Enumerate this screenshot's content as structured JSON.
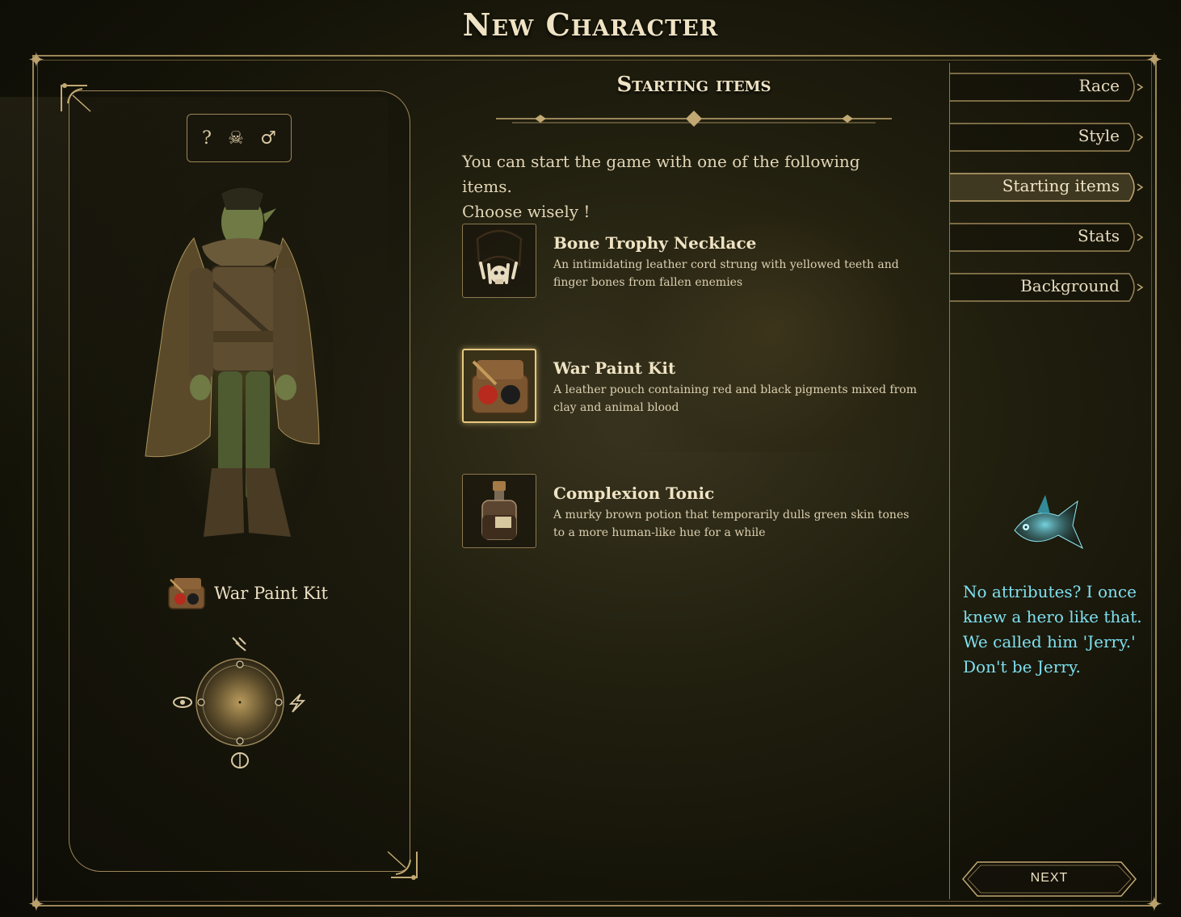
{
  "header": {
    "title": "New Character"
  },
  "character": {
    "tags": {
      "unknown": "?",
      "race_icon": "skull-icon",
      "gender_icon": "male-icon"
    },
    "selected_item": {
      "label": "War Paint Kit",
      "icon": "war-paint-kit-icon"
    },
    "attributes": [
      "dexterity-icon",
      "perception-icon",
      "energy-icon",
      "intellect-icon"
    ]
  },
  "starting_items": {
    "title": "Starting items",
    "intro": "You can start the game with one of the following items.\nChoose wisely !",
    "items": [
      {
        "name": "Bone Trophy Necklace",
        "description": "An intimidating leather cord strung with yellowed teeth and finger bones from fallen enemies",
        "icon": "bone-necklace-icon",
        "selected": false
      },
      {
        "name": "War Paint Kit",
        "description": "A leather pouch containing red and black pigments mixed from clay and animal blood",
        "icon": "war-paint-kit-icon",
        "selected": true
      },
      {
        "name": "Complexion Tonic",
        "description": "A murky brown potion that temporarily dulls green skin tones to a more human-like hue for a while",
        "icon": "potion-icon",
        "selected": false
      }
    ]
  },
  "nav": {
    "tabs": [
      {
        "label": "Race",
        "active": false
      },
      {
        "label": "Style",
        "active": false
      },
      {
        "label": "Starting items",
        "active": true
      },
      {
        "label": "Stats",
        "active": false
      },
      {
        "label": "Background",
        "active": false
      }
    ]
  },
  "companion": {
    "icon": "spectral-fish-icon",
    "quip": "No attributes? I once knew a hero like that. We called him 'Jerry.' Don't be Jerry."
  },
  "footer": {
    "next_label": "NEXT"
  },
  "colors": {
    "gold": "#9c8658",
    "text": "#e8dcc0",
    "quip": "#7fe0f0",
    "selected_border": "#e6c980"
  }
}
